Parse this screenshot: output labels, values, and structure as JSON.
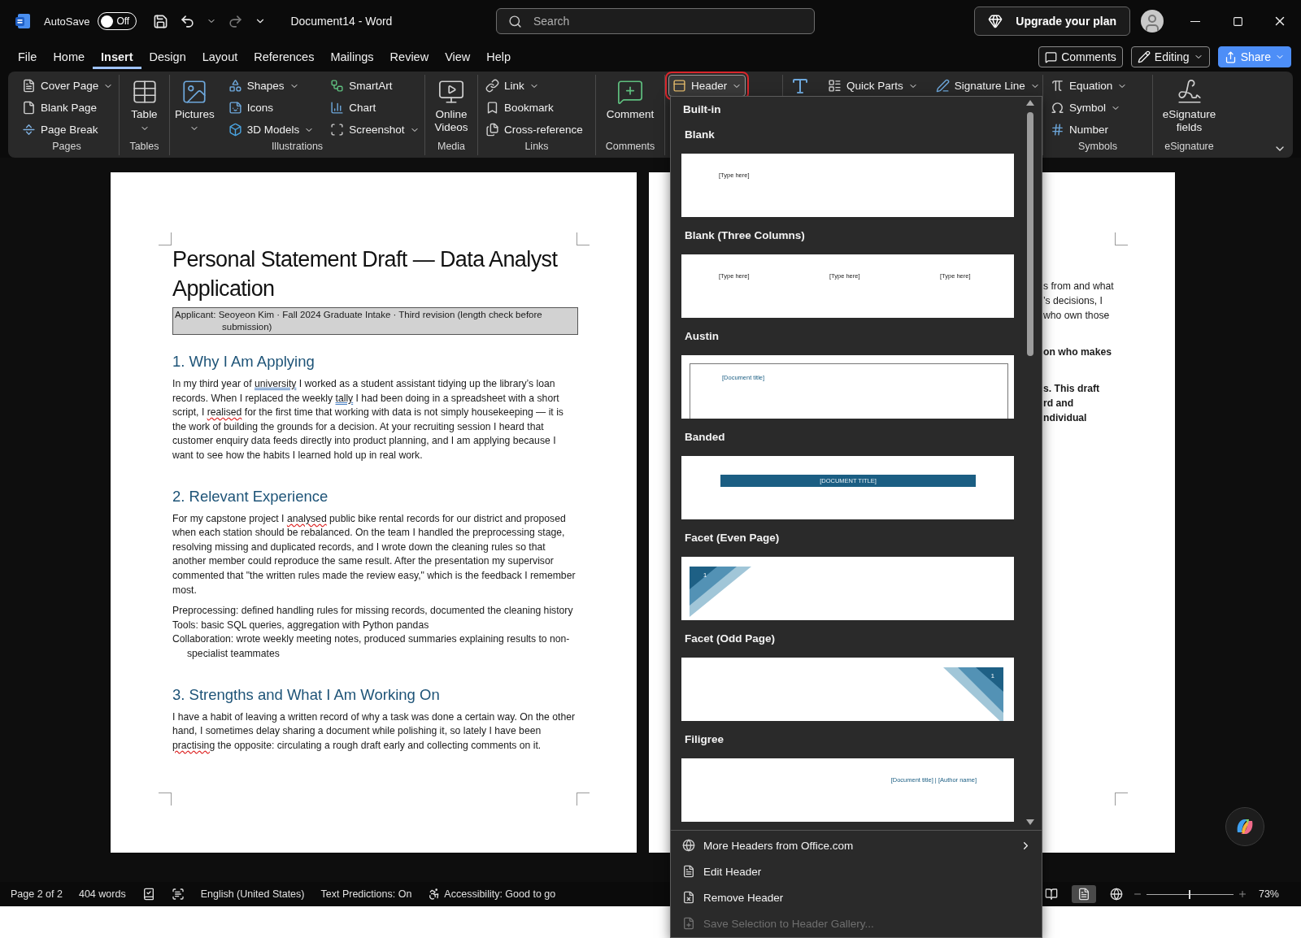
{
  "title_bar": {
    "autosave_label": "AutoSave",
    "autosave": {
      "on": false,
      "label": "Off"
    },
    "title": "Document14 - Word",
    "search": {
      "placeholder": "Search"
    },
    "upgrade": "Upgrade your plan"
  },
  "menu_tabs": [
    {
      "label": "File",
      "selected": false
    },
    {
      "label": "Home",
      "selected": false
    },
    {
      "label": "Insert",
      "selected": true
    },
    {
      "label": "Design",
      "selected": false
    },
    {
      "label": "Layout",
      "selected": false
    },
    {
      "label": "References",
      "selected": false
    },
    {
      "label": "Mailings",
      "selected": false
    },
    {
      "label": "Review",
      "selected": false
    },
    {
      "label": "View",
      "selected": false
    },
    {
      "label": "Help",
      "selected": false
    }
  ],
  "top_actions": [
    {
      "label": "Comments",
      "kind": "outline"
    },
    {
      "label": "Editing",
      "kind": "mode"
    },
    {
      "label": "Share",
      "kind": "primary"
    }
  ],
  "ribbon": {
    "groups": [
      {
        "label": "Pages",
        "columns": [
          {
            "kind": "stack",
            "items": [
              {
                "label": "Cover Page",
                "dropdown": true
              },
              {
                "label": "Blank Page",
                "dropdown": false
              },
              {
                "label": "Page Break",
                "dropdown": false
              }
            ]
          }
        ]
      },
      {
        "label": "Tables",
        "columns": [
          {
            "kind": "large",
            "items": [
              {
                "label": "Table",
                "dropdown": true
              }
            ]
          }
        ]
      },
      {
        "label": "Illustrations",
        "columns": [
          {
            "kind": "large",
            "items": [
              {
                "label": "Pictures",
                "dropdown": true
              }
            ]
          },
          {
            "kind": "stack",
            "items": [
              {
                "label": "Shapes",
                "dropdown": true
              },
              {
                "label": "Icons",
                "dropdown": false
              },
              {
                "label": "3D Models",
                "dropdown": true
              }
            ]
          },
          {
            "kind": "stack",
            "items": [
              {
                "label": "SmartArt",
                "dropdown": false
              },
              {
                "label": "Chart",
                "dropdown": false
              },
              {
                "label": "Screenshot",
                "dropdown": true
              }
            ]
          }
        ]
      },
      {
        "label": "Media",
        "columns": [
          {
            "kind": "large",
            "items": [
              {
                "label": "Online Videos",
                "dropdown": false
              }
            ]
          }
        ]
      },
      {
        "label": "Links",
        "columns": [
          {
            "kind": "stack",
            "items": [
              {
                "label": "Link",
                "dropdown": true
              },
              {
                "label": "Bookmark",
                "dropdown": false
              },
              {
                "label": "Cross-reference",
                "dropdown": false
              }
            ]
          }
        ]
      },
      {
        "label": "Comments",
        "columns": [
          {
            "kind": "large",
            "items": [
              {
                "label": "Comment",
                "dropdown": false
              }
            ]
          }
        ]
      },
      {
        "columns": [
          {
            "kind": "stack",
            "items": [
              {
                "label": "Header",
                "dropdown": true,
                "open": true
              }
            ]
          }
        ]
      },
      {
        "columns": [
          {
            "kind": "row",
            "items": [
              {
                "dropdown": false
              },
              {
                "label": "Quick Parts",
                "dropdown": true
              },
              {
                "label": "Signature Line",
                "dropdown": true
              }
            ]
          }
        ]
      },
      {
        "label": "Symbols",
        "columns": [
          {
            "kind": "stack",
            "items": [
              {
                "label": "Equation",
                "dropdown": true
              },
              {
                "label": "Symbol",
                "dropdown": true
              },
              {
                "label": "Number",
                "dropdown": false
              }
            ]
          }
        ]
      },
      {
        "label": "eSignature",
        "columns": [
          {
            "kind": "large",
            "items": [
              {
                "label": "eSignature fields",
                "dropdown": false
              }
            ]
          }
        ]
      }
    ]
  },
  "document": {
    "page": {
      "title": "Personal Statement Draft — Data Analyst Application",
      "subtitle": "Applicant: Seoyeon Kim · Fall 2024 Graduate Intake · Third revision (length check before submission)",
      "sections": [
        {
          "heading": "1. Why I Am Applying",
          "blocks": [
            {
              "kind": "paragraph",
              "runs": [
                "In my third year of ",
                {
                  "text": "university",
                  "kind": "grammar"
                },
                " I worked as a student assistant tidying up the library’s loan records. When I replaced the weekly ",
                {
                  "text": "tally",
                  "kind": "grammar"
                },
                " I had been doing in a spreadsheet with a short script, I ",
                {
                  "text": "realised",
                  "kind": "spelling"
                },
                " for the first time that working with data is not simply housekeeping — it is the work of building the grounds for a decision. At your recruiting session I heard that customer enquiry data feeds directly into product planning, and I am applying because I want to see how the habits I learned hold up in real work."
              ]
            }
          ]
        },
        {
          "heading": "2. Relevant Experience",
          "blocks": [
            {
              "kind": "paragraph",
              "runs": [
                "For my capstone project I ",
                {
                  "text": "analysed",
                  "kind": "spelling"
                },
                " public bike rental records for our district and proposed when each station should be rebalanced. On the team I handled the preprocessing stage, resolving missing and duplicated records, and I wrote down the cleaning rules so that another member could reproduce the same result. After the presentation my supervisor commented that \"the written rules made the review easy,\" which is the feedback I remember most."
              ]
            },
            {
              "kind": "list",
              "items": [
                "Preprocessing: defined handling rules for missing records, documented the cleaning history",
                "Tools: basic SQL queries, aggregation with Python pandas",
                "Collaboration: wrote weekly meeting notes, produced summaries explaining results to non-specialist teammates"
              ]
            }
          ]
        },
        {
          "heading": "3. Strengths and What I Am Working On",
          "blocks": [
            {
              "kind": "paragraph",
              "runs": [
                "I have a habit of leaving a written record of why a task was done a certain way. On the other hand, I sometimes delay sharing a document while polishing it, so lately I have been ",
                {
                  "text": "practising",
                  "kind": "spelling"
                },
                " the opposite: circulating a rough draft early and collecting comments on it."
              ]
            }
          ]
        }
      ]
    },
    "next_page": {
      "fragments": [
        {
          "bold": false,
          "lines": [
            "s from and what",
            "’s decisions, I",
            "who own those"
          ]
        },
        {
          "bold": true,
          "lines": [
            "on who makes"
          ]
        },
        {
          "bold": true,
          "lines": [
            "s. This draft",
            "rd and",
            "ndividual"
          ]
        }
      ]
    }
  },
  "header_gallery": {
    "section": "Built-in",
    "items": [
      {
        "name": "Blank",
        "preview": {
          "kind": "blank",
          "texts": [
            "[Type here]"
          ]
        }
      },
      {
        "name": "Blank (Three Columns)",
        "preview": {
          "kind": "columns",
          "texts": [
            "[Type here]",
            "[Type here]",
            "[Type here]"
          ]
        }
      },
      {
        "name": "Austin",
        "preview": {
          "kind": "framed",
          "texts": [
            "[Document title]"
          ]
        }
      },
      {
        "name": "Banded",
        "preview": {
          "kind": "band",
          "texts": [
            "[DOCUMENT TITLE]"
          ]
        }
      },
      {
        "name": "Facet (Even Page)",
        "preview": {
          "kind": "facet-left",
          "texts": [
            "1"
          ]
        }
      },
      {
        "name": "Facet (Odd Page)",
        "preview": {
          "kind": "facet-right",
          "texts": [
            "1"
          ]
        }
      },
      {
        "name": "Filigree",
        "preview": {
          "kind": "right-text",
          "texts": [
            "[Document title] | [Author name]"
          ]
        }
      }
    ],
    "menu": [
      {
        "label": "More Headers from Office.com",
        "submenu": true,
        "disabled": false
      },
      {
        "label": "Edit Header",
        "submenu": false,
        "disabled": false
      },
      {
        "label": "Remove Header",
        "submenu": false,
        "disabled": false
      },
      {
        "label": "Save Selection to Header Gallery...",
        "submenu": false,
        "disabled": true
      }
    ]
  },
  "status_bar": {
    "page": "Page 2 of 2",
    "words": "404 words",
    "language": "English (United States)",
    "predictions": "Text Predictions: On",
    "accessibility": "Accessibility: Good to go",
    "views": [
      {
        "selected": false
      },
      {
        "selected": true
      },
      {
        "selected": false
      }
    ],
    "zoom": {
      "level": 0.5,
      "label": "73%"
    }
  }
}
